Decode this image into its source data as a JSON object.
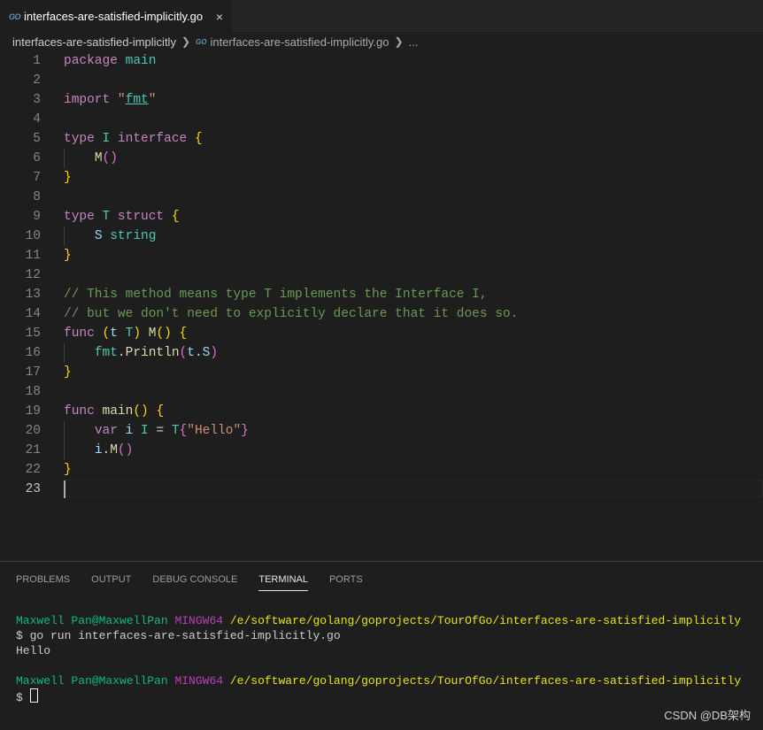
{
  "tab": {
    "title": "interfaces-are-satisfied-implicitly.go",
    "icon": "go-file-icon",
    "close": "×"
  },
  "breadcrumb": {
    "folder": "interfaces-are-satisfied-implicitly",
    "file": "interfaces-are-satisfied-implicitly.go",
    "more": "..."
  },
  "editor": {
    "line_numbers": [
      "1",
      "2",
      "3",
      "4",
      "5",
      "6",
      "7",
      "8",
      "9",
      "10",
      "11",
      "12",
      "13",
      "14",
      "15",
      "16",
      "17",
      "18",
      "19",
      "20",
      "21",
      "22",
      "23"
    ],
    "current_line": 23
  },
  "panel": {
    "tabs": [
      "PROBLEMS",
      "OUTPUT",
      "DEBUG CONSOLE",
      "TERMINAL",
      "PORTS"
    ],
    "active_tab": "TERMINAL"
  },
  "terminal": {
    "user": "Maxwell Pan@MaxwellPan",
    "host": "MINGW64",
    "path": "/e/software/golang/goprojects/TourOfGo/interfaces-are-satisfied-implicitly",
    "command": "$ go run interfaces-are-satisfied-implicitly.go",
    "output": "Hello",
    "prompt": "$"
  },
  "watermark": "CSDN @DB架构",
  "colors": {
    "keyword": "#c586c0",
    "type": "#4ec9b0",
    "function": "#dcdcaa",
    "string": "#ce9178",
    "comment": "#6a9955",
    "accent": "#007acc"
  }
}
